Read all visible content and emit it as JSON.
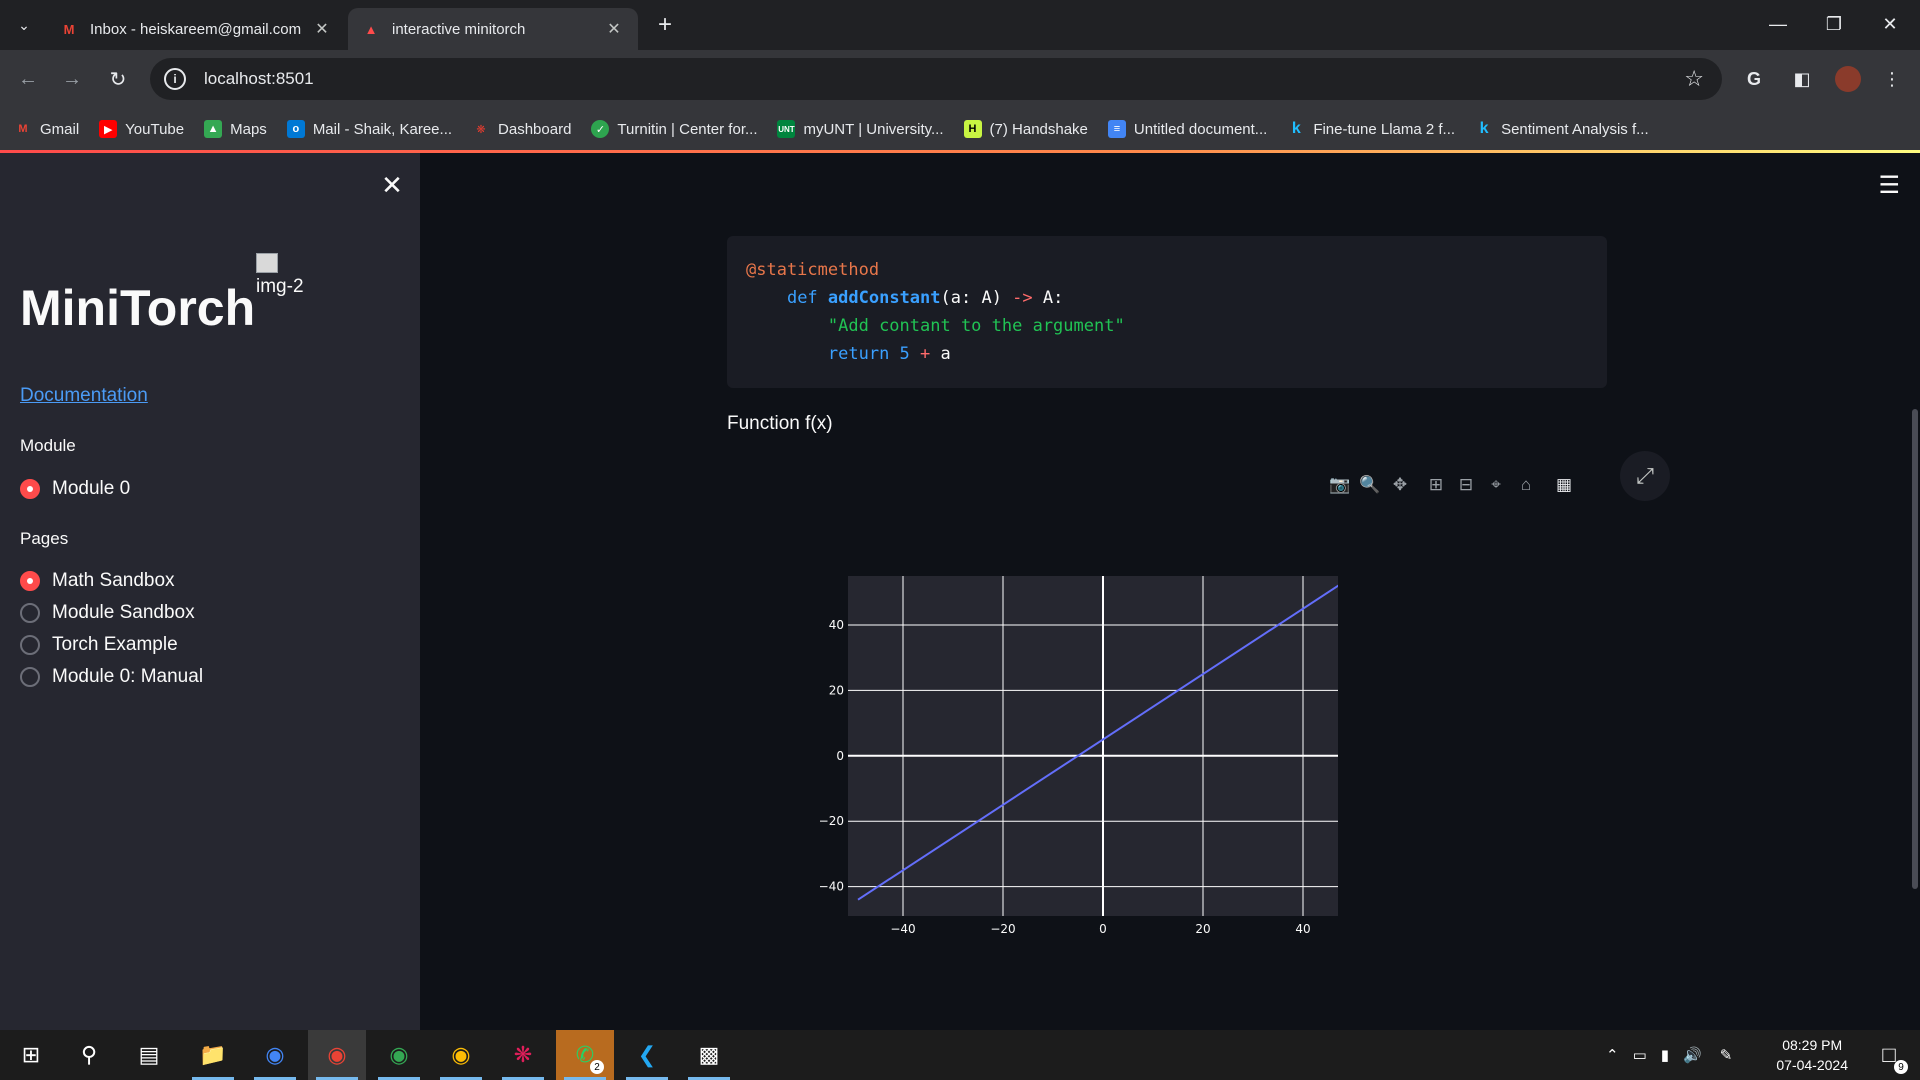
{
  "browser": {
    "tabs": [
      {
        "title": "Inbox - heiskareem@gmail.com",
        "favicon": "gmail-icon",
        "active": false
      },
      {
        "title": "interactive minitorch",
        "favicon": "streamlit-icon",
        "active": true
      }
    ],
    "url": "localhost:8501",
    "bookmarks": [
      {
        "label": "Gmail",
        "icon": "gmail-icon",
        "color": "#ea4335"
      },
      {
        "label": "YouTube",
        "icon": "youtube-icon",
        "color": "#ff0000"
      },
      {
        "label": "Maps",
        "icon": "maps-icon",
        "color": "#34a853"
      },
      {
        "label": "Mail - Shaik, Karee...",
        "icon": "outlook-icon",
        "color": "#0078d4"
      },
      {
        "label": "Dashboard",
        "icon": "canvas-icon",
        "color": "#e13c2f"
      },
      {
        "label": "Turnitin | Center for...",
        "icon": "turnitin-icon",
        "color": "#2ea44f"
      },
      {
        "label": "myUNT | University...",
        "icon": "unt-icon",
        "color": "#00853e"
      },
      {
        "label": "(7) Handshake",
        "icon": "handshake-icon",
        "color": "#c8f542"
      },
      {
        "label": "Untitled document...",
        "icon": "docs-icon",
        "color": "#4285f4"
      },
      {
        "label": "Fine-tune Llama 2 f...",
        "icon": "kaggle-icon",
        "color": "#20beff"
      },
      {
        "label": "Sentiment Analysis f...",
        "icon": "kaggle-icon",
        "color": "#20beff"
      }
    ]
  },
  "sidebar": {
    "brand": "MiniTorch",
    "broken_image_alt": "img-2",
    "doc_link": "Documentation",
    "module_label": "Module",
    "module_options": [
      {
        "label": "Module 0",
        "selected": true
      }
    ],
    "pages_label": "Pages",
    "page_options": [
      {
        "label": "Math Sandbox",
        "selected": true
      },
      {
        "label": "Module Sandbox",
        "selected": false
      },
      {
        "label": "Torch Example",
        "selected": false
      },
      {
        "label": "Module 0: Manual",
        "selected": false
      }
    ]
  },
  "main": {
    "code_lines": [
      {
        "dec": "@staticmethod"
      },
      {
        "kw": "def",
        "fn": "addConstant",
        "sig": "(a: A) ",
        "arrow": "->",
        "ret": " A:"
      },
      {
        "str": "\"Add contant to the argument\""
      },
      {
        "kw": "return",
        "num": " 5 ",
        "op": "+",
        "var": " a"
      }
    ],
    "section_title": "Function f(x)"
  },
  "chart_data": {
    "type": "line",
    "title": "",
    "xlabel": "",
    "ylabel": "",
    "xlim": [
      -51,
      47
    ],
    "ylim": [
      -49,
      55
    ],
    "x_ticks": [
      -40,
      -20,
      0,
      20,
      40
    ],
    "y_ticks": [
      -40,
      -20,
      0,
      20,
      40
    ],
    "series": [
      {
        "x": [
          -49,
          49
        ],
        "y": [
          -44,
          54
        ],
        "color": "#636efa"
      }
    ],
    "background": "#262730",
    "grid": true
  },
  "taskbar": {
    "time": "08:29 PM",
    "date": "07-04-2024",
    "whatsapp_badge": "2",
    "notification_badge": "9"
  }
}
